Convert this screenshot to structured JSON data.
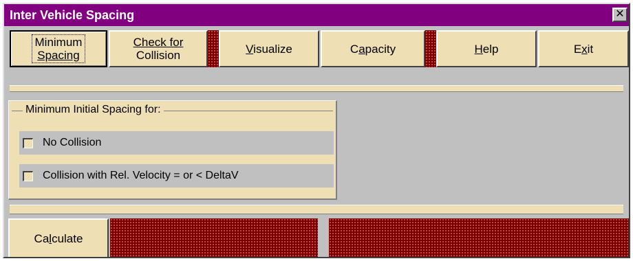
{
  "window": {
    "title": "Inter Vehicle Spacing",
    "close_glyph": "✕"
  },
  "toolbar": {
    "minimum_spacing": {
      "line1": "Minimum",
      "line2": "Spacing"
    },
    "check_collision": {
      "line1": "Check for",
      "line2": "Collision"
    },
    "visualize": {
      "mnemonic": "V",
      "rest": "isualize"
    },
    "capacity": {
      "before": "C",
      "mnemonic": "a",
      "after": "pacity"
    },
    "help": {
      "mnemonic": "H",
      "rest": "elp"
    },
    "exit": {
      "before": "E",
      "mnemonic": "x",
      "after": "it"
    }
  },
  "frame": {
    "label": "Minimum Initial Spacing for:",
    "options": [
      {
        "label": "No Collision",
        "checked": false
      },
      {
        "label": "Collision with Rel. Velocity = or < DeltaV",
        "checked": false
      }
    ]
  },
  "footer": {
    "calculate": {
      "before": "Ca",
      "mnemonic": "l",
      "after": "culate"
    }
  },
  "colors": {
    "title_bar": "#800080",
    "button_face": "#efdfb5",
    "hatch": "#7a0000",
    "background": "#c0c0c0"
  }
}
